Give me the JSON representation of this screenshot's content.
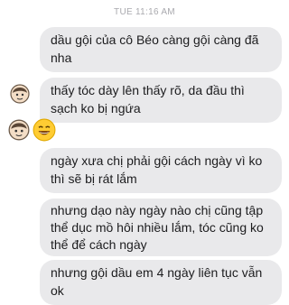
{
  "conversation": {
    "timestamp": "TUE 11:16 AM",
    "messages": [
      {
        "text": "dầu gội của cô Béo càng gội càng đã nha"
      },
      {
        "text": "thấy tóc dày lên thấy rõ, da đầu thì sạch ko bị ngứa"
      },
      {
        "text": "ngày xưa chị phải gội cách ngày vì ko thì sẽ bị rát lắm"
      },
      {
        "text": "nhưng dạo này ngày nào chị cũng tập thể dục mồ hôi nhiều lắm, tóc cũng ko thể để cách ngày"
      },
      {
        "text": "nhưng gội dầu em 4 ngày liên tục vẫn ok"
      }
    ],
    "icons": [
      "face-icon",
      "grinning-emoji-icon"
    ],
    "colors": {
      "bubble": "#e9e9eb",
      "text": "#1c1c1e",
      "timestamp": "#a9a9ae"
    }
  }
}
